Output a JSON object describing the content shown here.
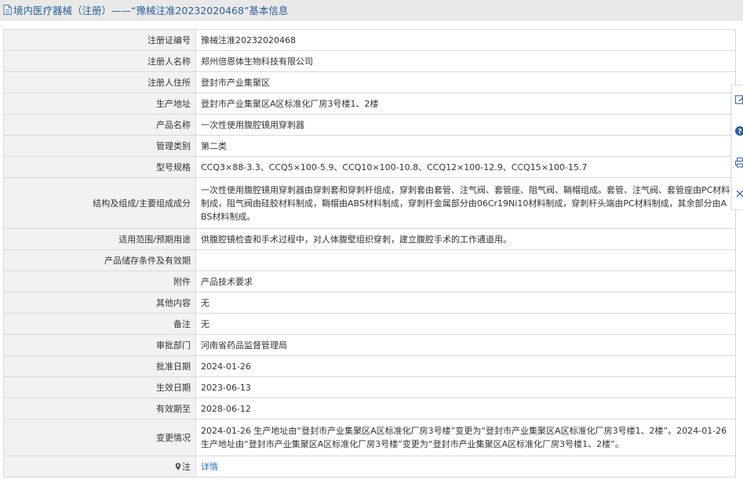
{
  "title": "境内医疗器械（注册）——“豫械注准20232020468”基本信息",
  "rows": [
    {
      "label": "注册证编号",
      "value": "豫械注准20232020468"
    },
    {
      "label": "注册人名称",
      "value": "郑州倍恩体生物科技有限公司"
    },
    {
      "label": "注册人住所",
      "value": "登封市产业集聚区"
    },
    {
      "label": "生产地址",
      "value": "登封市产业集聚区A区标准化厂房3号楼1、2楼"
    },
    {
      "label": "产品名称",
      "value": "一次性使用腹腔镜用穿刺器"
    },
    {
      "label": "管理类别",
      "value": "第二类"
    },
    {
      "label": "型号规格",
      "value": "CCQ3×88-3.3、CCQ5×100-5.9、CCQ10×100-10.8、CCQ12×100-12.9、CCQ15×100-15.7"
    },
    {
      "label": "结构及组成/主要组成成分",
      "value": "一次性使用腹腔镜用穿刺器由穿刺套和穿刺杆组成，穿刺套由套管、注气阀、套管座、阻气阀、鞘帽组成。套管、注气阀、套管座由PC材料制成，阻气阀由硅胶材料制成，鞘帽由ABS材料制成，穿刺杆金属部分由06Cr19Ni10材料制成，穿刺杆头端由PC材料制成，其余部分由ABS材料制成。"
    },
    {
      "label": "适用范围/预期用途",
      "value": "供腹腔镜检查和手术过程中，对人体腹壁组织穿刺，建立腹腔手术的工作通道用。"
    },
    {
      "label": "产品储存条件及有效期",
      "value": ""
    },
    {
      "label": "附件",
      "value": "产品技术要求"
    },
    {
      "label": "其他内容",
      "value": "无"
    },
    {
      "label": "备注",
      "value": "无"
    },
    {
      "label": "审批部门",
      "value": "河南省药品监督管理局"
    },
    {
      "label": "批准日期",
      "value": "2024-01-26"
    },
    {
      "label": "生效日期",
      "value": "2023-06-13"
    },
    {
      "label": "有效期至",
      "value": "2028-06-12"
    },
    {
      "label": "变更情况",
      "value": "2024-01-26 生产地址由“登封市产业集聚区A区标准化厂房3号楼”变更为“登封市产业集聚区A区标准化厂房3号楼1、2楼”。2024-01-26生产地址由“登封市产业集聚区A区标准化厂房3号楼”变更为“登封市产业集聚区A区标准化厂房3号楼1、2楼”。"
    }
  ],
  "note": {
    "label": "注",
    "link_text": "详情"
  },
  "side_tools": [
    "edit-icon",
    "help-icon",
    "print-icon",
    "close-icon"
  ],
  "colors": {
    "title_text": "#2b5f99",
    "link": "#2b6fb5",
    "label_bg": "#f2f2f2",
    "border": "#d9d9d9"
  }
}
